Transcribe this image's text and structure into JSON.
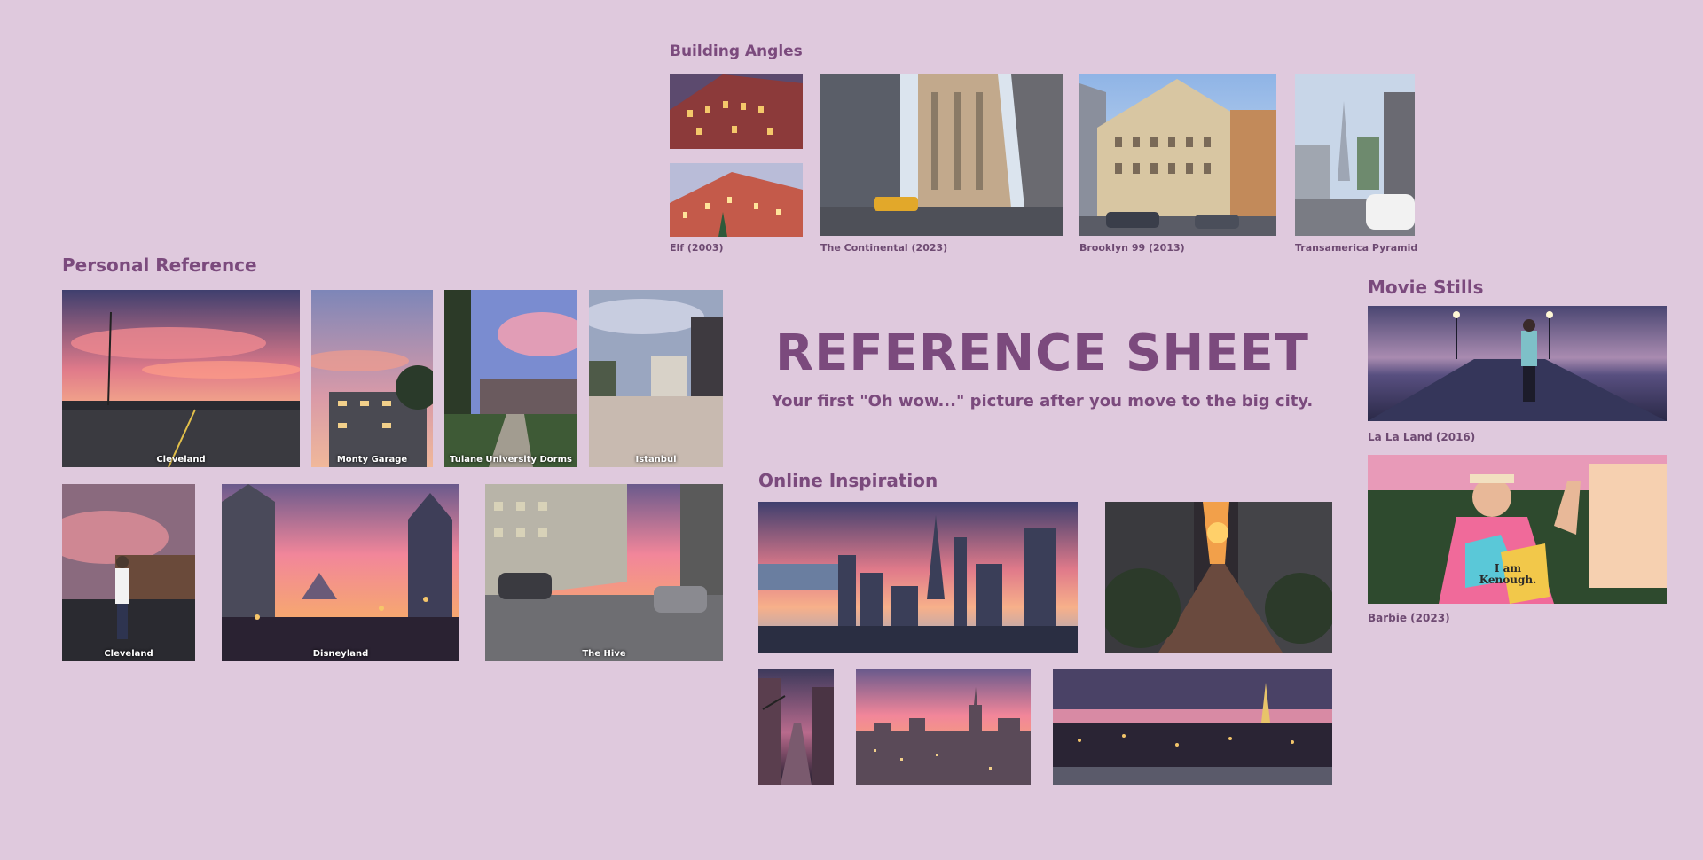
{
  "title": "REFERENCE SHEET",
  "subtitle": "Your first \"Oh wow...\" picture after you move to the big city.",
  "sections": {
    "building_angles": {
      "title": "Building Angles",
      "captions": [
        "Elf (2003)",
        "The Continental (2023)",
        "Brooklyn 99 (2013)",
        "Transamerica Pyramid"
      ]
    },
    "personal_reference": {
      "title": "Personal Reference",
      "photos": [
        "Cleveland",
        "Monty Garage",
        "Tulane University Dorms",
        "Istanbul",
        "Cleveland",
        "Disneyland",
        "The Hive"
      ]
    },
    "online_inspiration": {
      "title": "Online Inspiration"
    },
    "movie_stills": {
      "title": "Movie Stills",
      "captions": [
        "La La Land (2016)",
        "Barbie (2023)"
      ],
      "barbie_hoodie_text": "I am Kenough."
    }
  },
  "colors": {
    "background": "#dfc9dd",
    "accent": "#7b4a7d",
    "sunset_pink": "#f28a8f",
    "dusk_purple": "#4a4266"
  }
}
